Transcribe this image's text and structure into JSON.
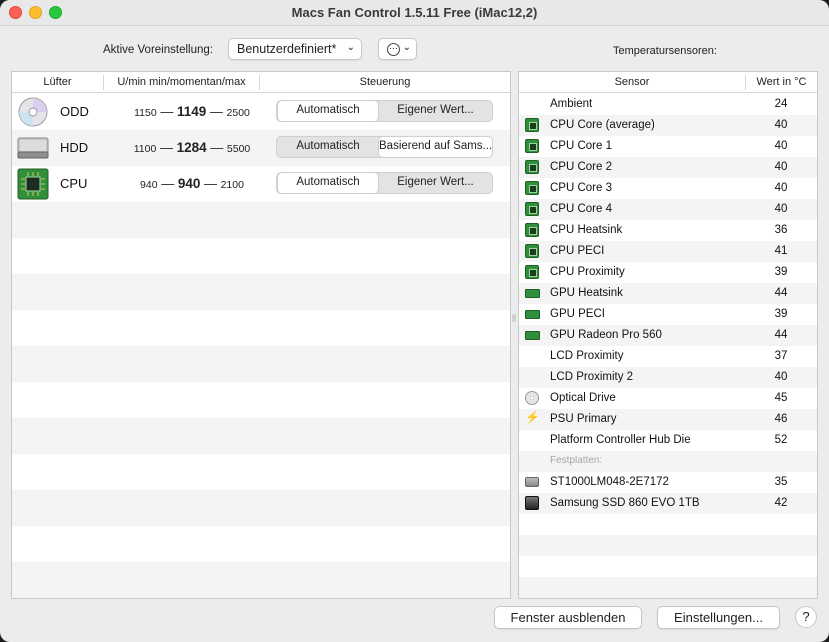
{
  "window": {
    "title": "Macs Fan Control 1.5.11 Free (iMac12,2)"
  },
  "preset": {
    "label": "Aktive Voreinstellung:",
    "value": "Benutzerdefiniert*"
  },
  "sensors_title": "Temperatursensoren:",
  "fan_table": {
    "headers": [
      "Lüfter",
      "U/min min/momentan/max",
      "Steuerung"
    ],
    "rows": [
      {
        "icon": "optical-drive-icon",
        "name": "ODD",
        "min": "1150",
        "current": "1149",
        "max": "2500",
        "control_auto": "Automatisch",
        "control_custom": "Eigener Wert...",
        "selected": "auto"
      },
      {
        "icon": "hard-disk-icon",
        "name": "HDD",
        "min": "1100",
        "current": "1284",
        "max": "5500",
        "control_auto": "Automatisch",
        "control_custom": "Basierend auf Sams...",
        "selected": "custom"
      },
      {
        "icon": "cpu-chip-icon",
        "name": "CPU",
        "min": "940",
        "current": "940",
        "max": "2100",
        "control_auto": "Automatisch",
        "control_custom": "Eigener Wert...",
        "selected": "auto"
      }
    ],
    "separator": "—"
  },
  "sensor_table": {
    "headers": [
      "Sensor",
      "Wert in °C"
    ],
    "rows": [
      {
        "icon": "",
        "name": "Ambient",
        "value": "24"
      },
      {
        "icon": "chip",
        "name": "CPU Core (average)",
        "value": "40"
      },
      {
        "icon": "chip",
        "name": "CPU Core 1",
        "value": "40"
      },
      {
        "icon": "chip",
        "name": "CPU Core 2",
        "value": "40"
      },
      {
        "icon": "chip",
        "name": "CPU Core 3",
        "value": "40"
      },
      {
        "icon": "chip",
        "name": "CPU Core 4",
        "value": "40"
      },
      {
        "icon": "chip",
        "name": "CPU Heatsink",
        "value": "36"
      },
      {
        "icon": "chip",
        "name": "CPU PECI",
        "value": "41"
      },
      {
        "icon": "chip",
        "name": "CPU Proximity",
        "value": "39"
      },
      {
        "icon": "gpu",
        "name": "GPU Heatsink",
        "value": "44"
      },
      {
        "icon": "gpu",
        "name": "GPU PECI",
        "value": "39"
      },
      {
        "icon": "gpu",
        "name": "GPU Radeon Pro 560",
        "value": "44"
      },
      {
        "icon": "",
        "name": "LCD Proximity",
        "value": "37"
      },
      {
        "icon": "",
        "name": "LCD Proximity 2",
        "value": "40"
      },
      {
        "icon": "disc",
        "name": "Optical Drive",
        "value": "45"
      },
      {
        "icon": "bolt",
        "name": "PSU Primary",
        "value": "46"
      },
      {
        "icon": "",
        "name": "Platform Controller Hub Die",
        "value": "52"
      },
      {
        "header": "Festplatten:"
      },
      {
        "icon": "hdd",
        "name": "ST1000LM048-2E7172",
        "value": "35"
      },
      {
        "icon": "ssd",
        "name": "Samsung SSD 860 EVO 1TB",
        "value": "42"
      }
    ]
  },
  "buttons": {
    "hide": "Fenster ausblenden",
    "settings": "Einstellungen...",
    "help": "?"
  },
  "colors": {
    "accent_green": "#2f8f3a",
    "close": "#fe5f57",
    "minimize": "#febc2e",
    "maximize": "#28c840"
  }
}
